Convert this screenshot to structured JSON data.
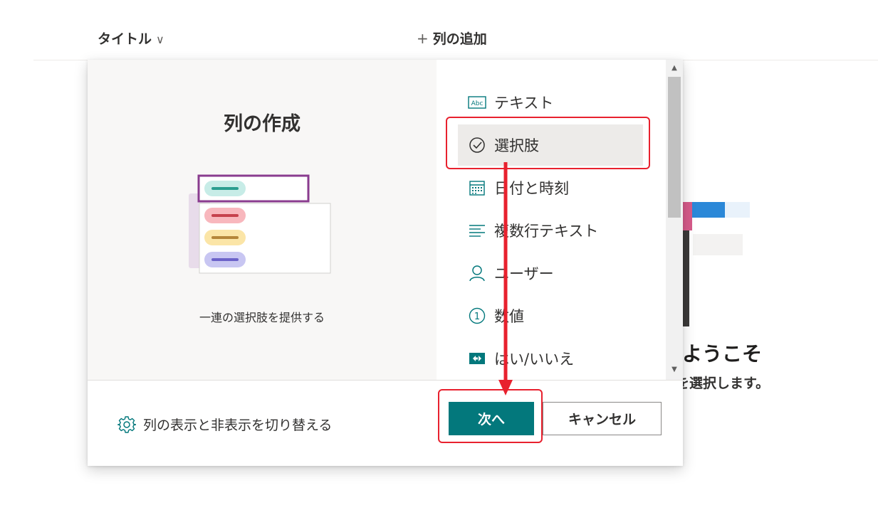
{
  "header": {
    "title": "タイトル",
    "title_chevron": "∨",
    "add_column_plus": "+",
    "add_column": "列の追加"
  },
  "background": {
    "welcome_title": "へようこそ",
    "welcome_sub": "ンを選択します。"
  },
  "dialog": {
    "title": "列の作成",
    "description": "一連の選択肢を提供する",
    "types": [
      {
        "label": "テキスト",
        "icon": "text-abc-icon"
      },
      {
        "label": "選択肢",
        "icon": "choice-check-icon",
        "selected": true
      },
      {
        "label": "日付と時刻",
        "icon": "calendar-icon"
      },
      {
        "label": "複数行テキスト",
        "icon": "multiline-text-icon"
      },
      {
        "label": "ユーザー",
        "icon": "person-icon"
      },
      {
        "label": "数値",
        "icon": "number-icon"
      },
      {
        "label": "はい/いいえ",
        "icon": "yes-no-icon"
      }
    ],
    "abc_icon_text": "Abc",
    "number_icon_text": "1",
    "footer": {
      "toggle_label": "列の表示と非表示を切り替える",
      "next_label": "次へ",
      "cancel_label": "キャンセル"
    }
  },
  "colors": {
    "accent": "#03787c",
    "annotation_red": "#e8212e",
    "selected_bg": "#edebe9"
  }
}
